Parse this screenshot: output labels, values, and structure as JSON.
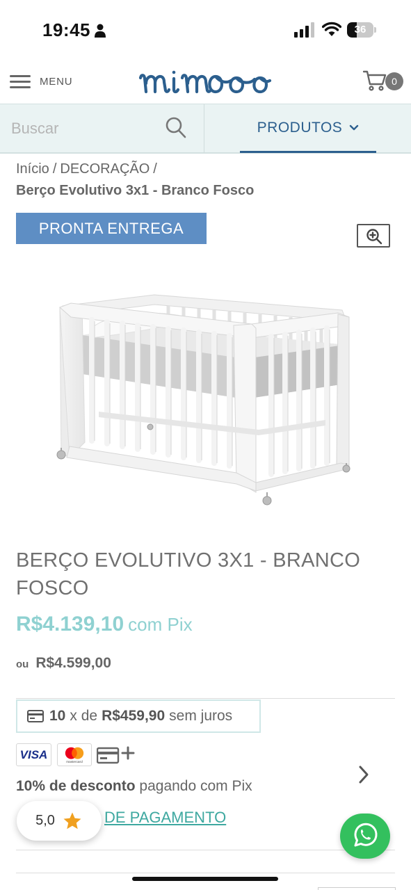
{
  "status_bar": {
    "time": "19:45",
    "battery": "36",
    "battery_level": 0.36,
    "icons": [
      "person-icon",
      "signal-icon",
      "wifi-icon",
      "battery-icon"
    ]
  },
  "header": {
    "menu_label": "MENU",
    "logo_text": "mimoo",
    "cart_count": "0",
    "brand_color": "#2c5f8e"
  },
  "search": {
    "placeholder": "Buscar",
    "products_label": "PRODUTOS"
  },
  "breadcrumb": {
    "home": "Início",
    "category": "DECORAÇÃO",
    "current": "Berço Evolutivo 3x1 - Branco Fosco"
  },
  "product": {
    "badge": "PRONTA ENTREGA",
    "title": "BERÇO EVOLUTIVO 3X1 - BRANCO FOSCO",
    "price_pix": "R$4.139,10",
    "pix_label": "com Pix",
    "ou": "ou",
    "price_regular": "R$4.599,00",
    "installments": {
      "count": "10",
      "x_de": "x de",
      "amount": "R$459,90",
      "suffix": "sem juros"
    },
    "discount_bold": "10% de desconto",
    "discount_rest": "pagando com Pix",
    "payment_link": "DE PAGAMENTO",
    "payment_methods": [
      "VISA",
      "mastercard"
    ]
  },
  "rating": {
    "value": "5,0"
  },
  "colors": {
    "accent_price": "#8fd1d1",
    "badge_bg": "#5e8ec4",
    "link": "#3ea8a0",
    "whatsapp": "#33c05e",
    "star": "#f0a020"
  }
}
